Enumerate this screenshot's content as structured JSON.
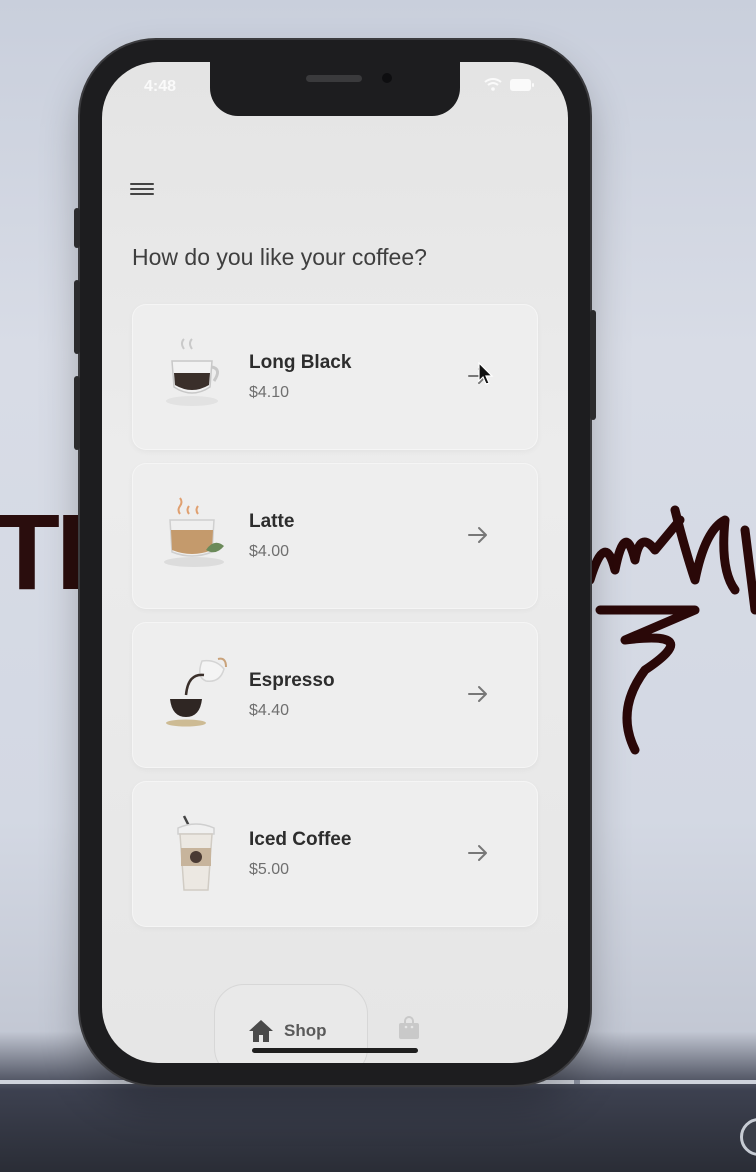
{
  "background": {
    "left_text": "TE"
  },
  "status_bar": {
    "time": "4:48"
  },
  "header": {
    "question": "How do you like your coffee?"
  },
  "products": [
    {
      "name": "Long Black",
      "price": "$4.10",
      "icon": "long-black-cup-icon"
    },
    {
      "name": "Latte",
      "price": "$4.00",
      "icon": "latte-cup-icon"
    },
    {
      "name": "Espresso",
      "price": "$4.40",
      "icon": "espresso-pour-icon"
    },
    {
      "name": "Iced Coffee",
      "price": "$5.00",
      "icon": "iced-coffee-cup-icon"
    }
  ],
  "bottom_nav": {
    "shop_label": "Shop",
    "items": [
      "home-icon",
      "shopping-bag-icon"
    ]
  },
  "colors": {
    "accent_text": "#2d2d2d",
    "price_text": "#6f6f6f",
    "card_bg": "#eeeeee"
  }
}
